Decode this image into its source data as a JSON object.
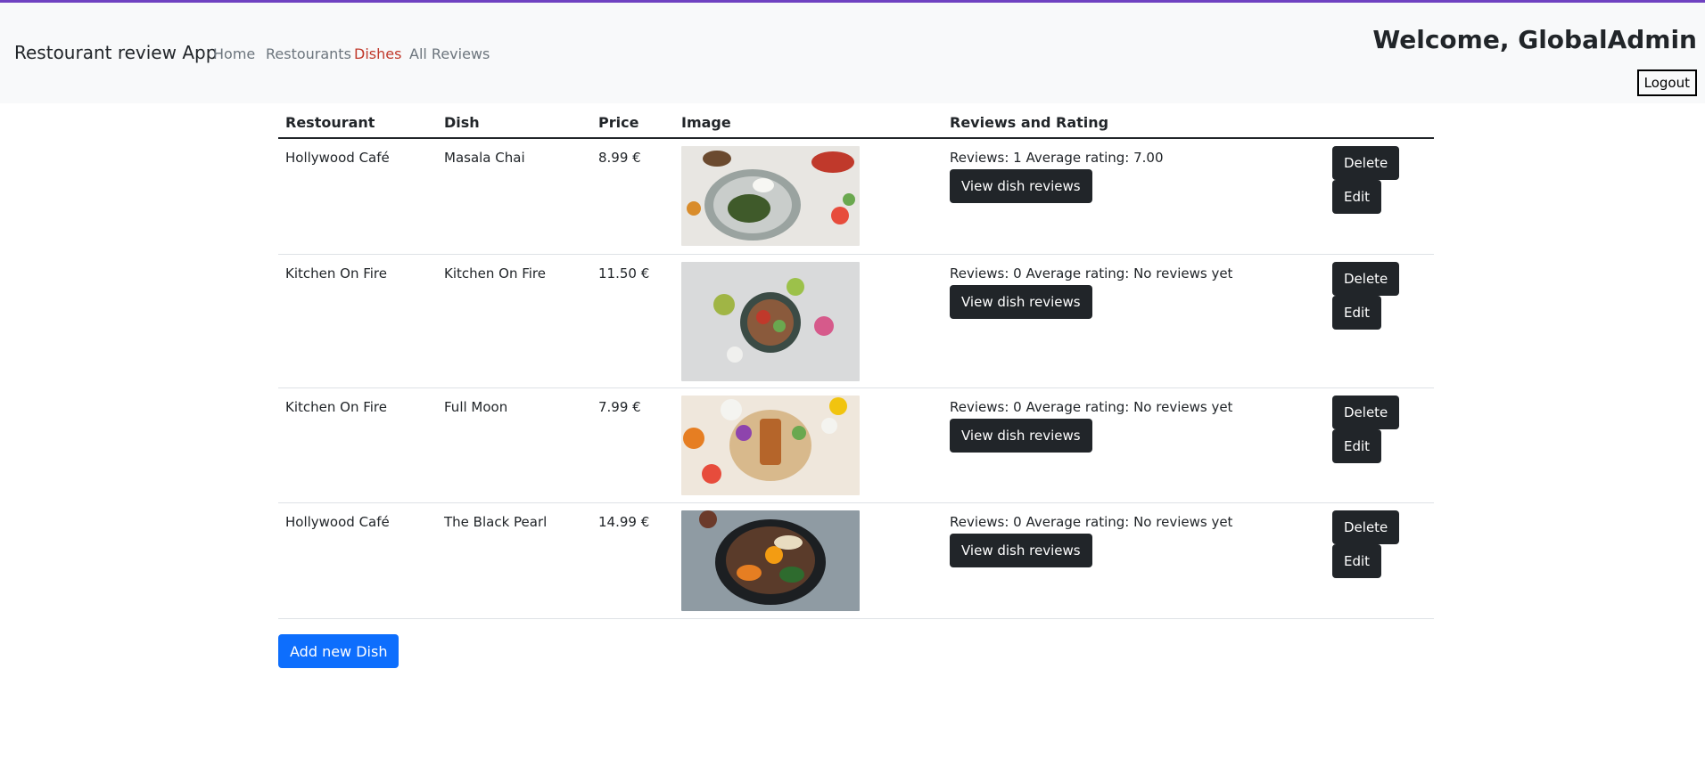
{
  "app": {
    "brand": "Restourant review App",
    "nav": [
      {
        "label": "Home"
      },
      {
        "label": "Restourants"
      },
      {
        "label": "Dishes"
      },
      {
        "label": "All Reviews"
      }
    ],
    "welcome": "Welcome, GlobalAdmin",
    "logout_label": "Logout"
  },
  "table": {
    "headers": [
      "Restourant",
      "Dish",
      "Price",
      "Image",
      "Reviews and Rating"
    ],
    "view_reviews_label": "View dish reviews",
    "delete_label": "Delete",
    "edit_label": "Edit",
    "rows": [
      {
        "restaurant": "Hollywood Café",
        "dish": "Masala Chai",
        "price": "8.99 €",
        "reviews": "Reviews: 1 Average rating: 7.00"
      },
      {
        "restaurant": "Kitchen On Fire",
        "dish": "Kitchen On Fire",
        "price": "11.50 €",
        "reviews": "Reviews: 0 Average rating: No reviews yet"
      },
      {
        "restaurant": "Kitchen On Fire",
        "dish": "Full Moon",
        "price": "7.99 €",
        "reviews": "Reviews: 0 Average rating: No reviews yet"
      },
      {
        "restaurant": "Hollywood Café",
        "dish": "The Black Pearl",
        "price": "14.99 €",
        "reviews": "Reviews: 0 Average rating: No reviews yet"
      }
    ]
  },
  "add_dish_label": "Add new Dish",
  "colors": {
    "accent_top": "#6f42c1",
    "active_nav": "#c0392b",
    "primary": "#0d6efd",
    "dark": "#212529"
  }
}
